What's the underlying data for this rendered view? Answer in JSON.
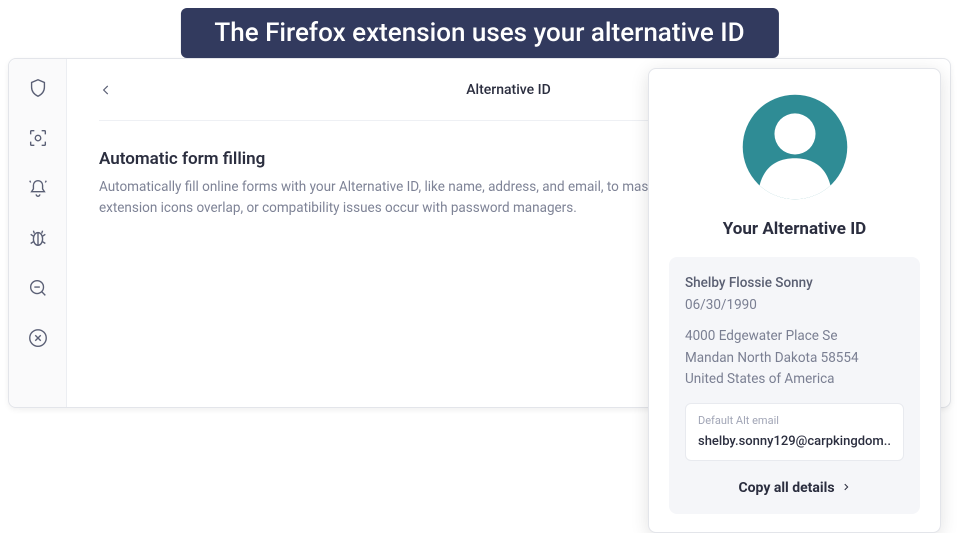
{
  "banner": "The Firefox extension uses your alternative ID",
  "header": {
    "title": "Alternative ID"
  },
  "section": {
    "title": "Automatic form filling",
    "description": "Automatically fill online forms with your Alternative ID, like name, address, and email, to mask your real information. Turn it off if other extension icons overlap, or compatibility issues occur with password managers."
  },
  "card": {
    "title": "Your Alternative ID",
    "name": "Shelby Flossie Sonny",
    "dob": "06/30/1990",
    "address_line1": "4000 Edgewater Place Se",
    "address_line2": "Mandan North Dakota 58554",
    "country": "United States of America",
    "email_label": "Default Alt email",
    "email": "shelby.sonny129@carpkingdom....",
    "copy_label": "Copy all details"
  },
  "colors": {
    "banner_bg": "#323a5e",
    "avatar_accent": "#2f8c95"
  }
}
